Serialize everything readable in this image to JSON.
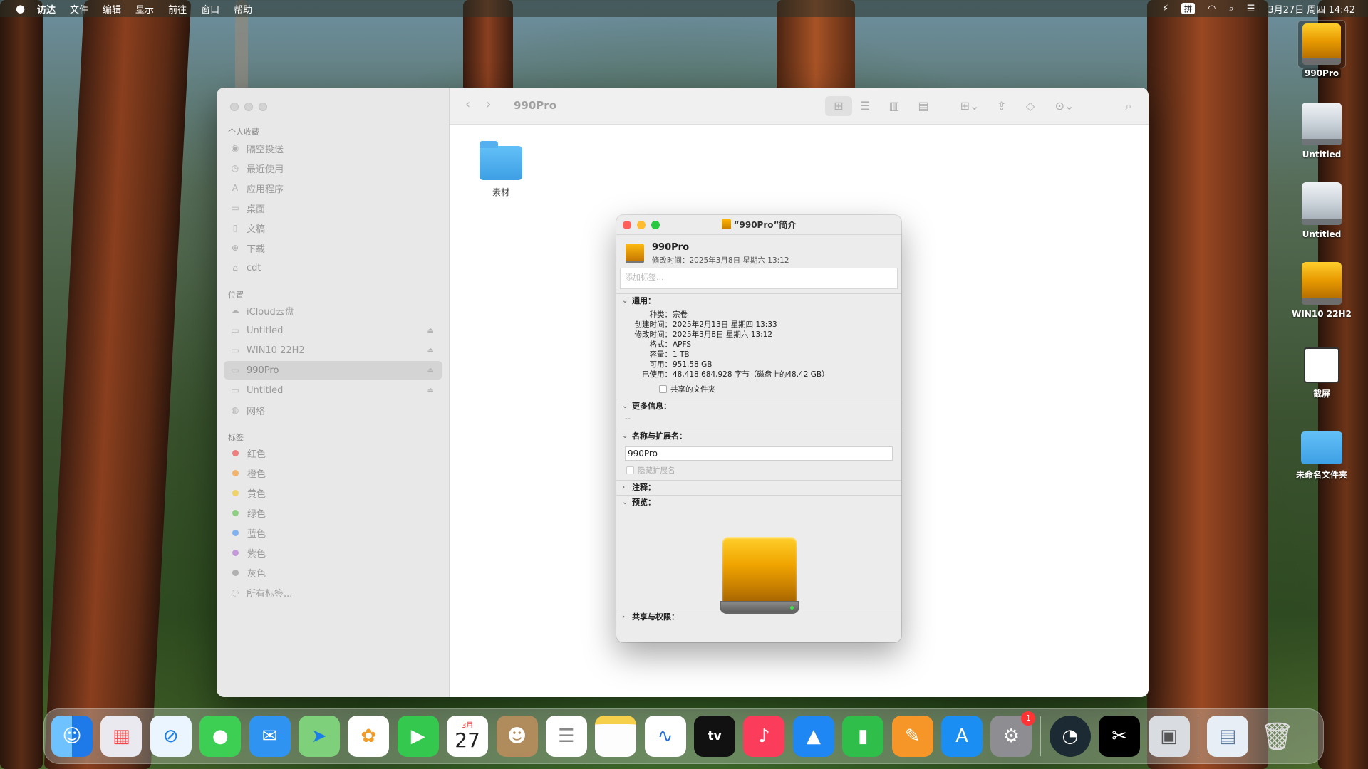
{
  "menubar": {
    "apple": "",
    "items": [
      "访达",
      "文件",
      "编辑",
      "显示",
      "前往",
      "窗口",
      "帮助"
    ],
    "ime": "拼",
    "datetime": "3月27日 周四  14:42"
  },
  "finder": {
    "title": "990Pro",
    "sidebar": {
      "favorites_header": "个人收藏",
      "favorites": [
        "隔空投送",
        "最近使用",
        "应用程序",
        "桌面",
        "文稿",
        "下载",
        "cdt"
      ],
      "locations_header": "位置",
      "locations": [
        "iCloud云盘",
        "Untitled",
        "WIN10 22H2",
        "990Pro",
        "Untitled",
        "网络"
      ],
      "tags_header": "标签",
      "tags": [
        {
          "label": "红色",
          "color": "#ee7f7f"
        },
        {
          "label": "橙色",
          "color": "#f2b46b"
        },
        {
          "label": "黄色",
          "color": "#efd26a"
        },
        {
          "label": "绿色",
          "color": "#8fcf84"
        },
        {
          "label": "蓝色",
          "color": "#7fb2ee"
        },
        {
          "label": "紫色",
          "color": "#c49ad9"
        },
        {
          "label": "灰色",
          "color": "#b0b0b0"
        }
      ],
      "all_tags": "所有标签..."
    },
    "items": [
      {
        "name": "素材",
        "icon": "folder-icon"
      }
    ]
  },
  "info": {
    "window_title": "“990Pro”简介",
    "name": "990Pro",
    "modified_header": "修改时间：2025年3月8日 星期六 13:12",
    "tag_placeholder": "添加标签...",
    "general_header": "通用：",
    "general": [
      {
        "k": "种类：",
        "v": "宗卷"
      },
      {
        "k": "创建时间：",
        "v": "2025年2月13日 星期四 13:33"
      },
      {
        "k": "修改时间：",
        "v": "2025年3月8日 星期六 13:12"
      },
      {
        "k": "格式：",
        "v": "APFS"
      },
      {
        "k": "容量：",
        "v": "1 TB"
      },
      {
        "k": "可用：",
        "v": "951.58 GB"
      },
      {
        "k": "已使用：",
        "v": "48,418,684,928 字节（磁盘上的48.42 GB）"
      }
    ],
    "shared_folder": "共享的文件夹",
    "more_info_header": "更多信息：",
    "more_info_value": "--",
    "name_ext_header": "名称与扩展名：",
    "name_field": "990Pro",
    "hide_ext": "隐藏扩展名",
    "comments_header": "注释：",
    "preview_header": "预览：",
    "sharing_header": "共享与权限："
  },
  "desktop": [
    "990Pro",
    "Untitled",
    "Untitled",
    "WIN10 22H2",
    "截屏",
    "未命名文件夹"
  ],
  "dock": {
    "calendar_month": "3月",
    "calendar_day": "27",
    "settings_badge": "1",
    "tv_label": "tv"
  }
}
